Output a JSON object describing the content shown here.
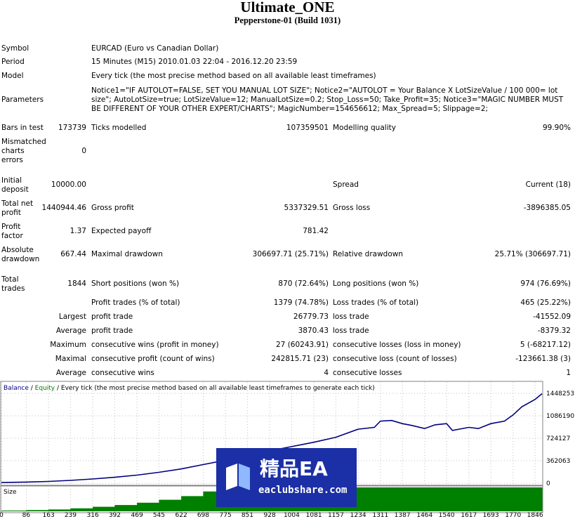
{
  "report": {
    "title": "Ultimate_ONE",
    "subtitle": "Pepperstone-01 (Build 1031)"
  },
  "info": {
    "symbol_label": "Symbol",
    "symbol": "EURCAD (Euro vs Canadian Dollar)",
    "period_label": "Period",
    "period": "15 Minutes (M15) 2010.01.03 22:04 - 2016.12.20 23:59",
    "model_label": "Model",
    "model": "Every tick (the most precise method based on all available least timeframes)",
    "parameters_label": "Parameters",
    "parameters": "Notice1=\"IF AUTOLOT=FALSE, SET YOU MANUAL LOT SIZE\"; Notice2=\"AUTOLOT = Your Balance X LotSizeValue / 100 000= lot size\"; AutoLotSize=true; LotSizeValue=12; ManualLotSize=0.2; Stop_Loss=50; Take_Profit=35; Notice3=\"MAGIC NUMBER MUST BE DIFFERENT OF YOUR OTHER EXPERT/CHARTS\"; MagicNumber=154656612; Max_Spread=5; Slippage=2;"
  },
  "stats": {
    "bars_label": "Bars in test",
    "bars": "173739",
    "ticks_label": "Ticks modelled",
    "ticks": "107359501",
    "quality_label": "Modelling quality",
    "quality": "99.90%",
    "mismatch_label": "Mismatched charts errors",
    "mismatch": "0",
    "deposit_label": "Initial deposit",
    "deposit": "10000.00",
    "spread_label": "Spread",
    "spread": "Current (18)",
    "netprofit_label": "Total net profit",
    "netprofit": "1440944.46",
    "grossprofit_label": "Gross profit",
    "grossprofit": "5337329.51",
    "grossloss_label": "Gross loss",
    "grossloss": "-3896385.05",
    "pf_label": "Profit factor",
    "pf": "1.37",
    "payoff_label": "Expected payoff",
    "payoff": "781.42",
    "absdd_label": "Absolute drawdown",
    "absdd": "667.44",
    "maxdd_label": "Maximal drawdown",
    "maxdd": "306697.71 (25.71%)",
    "reldd_label": "Relative drawdown",
    "reldd": "25.71% (306697.71)",
    "trades_label": "Total trades",
    "trades": "1844",
    "short_label": "Short positions (won %)",
    "short": "870 (72.64%)",
    "long_label": "Long positions (won %)",
    "long": "974 (76.69%)",
    "profittr_label": "Profit trades (% of total)",
    "profittr": "1379 (74.78%)",
    "losstr_label": "Loss trades (% of total)",
    "losstr": "465 (25.22%)",
    "largest_label": "Largest",
    "largest_p_label": "profit trade",
    "largest_p": "26779.73",
    "largest_l_label": "loss trade",
    "largest_l": "-41552.09",
    "average_label": "Average",
    "average_p_label": "profit trade",
    "average_p": "3870.43",
    "average_l_label": "loss trade",
    "average_l": "-8379.32",
    "maximum_label": "Maximum",
    "maxwins_label": "consecutive wins (profit in money)",
    "maxwins": "27 (60243.91)",
    "maxloss_label": "consecutive losses (loss in money)",
    "maxloss": "5 (-68217.12)",
    "maximal_label": "Maximal",
    "maxprofit_label": "consecutive profit (count of wins)",
    "maxprofit": "242815.71 (23)",
    "maxlosscount_label": "consecutive loss (count of losses)",
    "maxlosscount": "-123661.38 (3)",
    "average2_label": "Average",
    "avgwins_label": "consecutive wins",
    "avgwins": "4",
    "avglosses_label": "consecutive losses",
    "avglosses": "1"
  },
  "chart_data": {
    "type": "line",
    "legend_balance": "Balance",
    "legend_sep": " / ",
    "legend_equity": "Equity",
    "legend_rest": " / Every tick (the most precise method based on all available least timeframes to generate each tick)",
    "size_label": "Size",
    "y_ticks": [
      "1448253",
      "1086190",
      "724127",
      "362063",
      "0"
    ],
    "x_ticks": [
      "0",
      "86",
      "163",
      "239",
      "316",
      "392",
      "469",
      "545",
      "622",
      "698",
      "775",
      "851",
      "928",
      "1004",
      "1081",
      "1157",
      "1234",
      "1311",
      "1387",
      "1464",
      "1540",
      "1617",
      "1693",
      "1770",
      "1846"
    ],
    "series": [
      {
        "name": "Balance",
        "x": [
          0,
          86,
          163,
          239,
          316,
          392,
          469,
          545,
          622,
          698,
          775,
          851,
          928,
          1004,
          1081,
          1157,
          1234,
          1290,
          1311,
          1350,
          1387,
          1420,
          1464,
          1500,
          1540,
          1560,
          1617,
          1650,
          1693,
          1740,
          1770,
          1800,
          1846,
          1870
        ],
        "values": [
          10000,
          18000,
          28000,
          45000,
          68000,
          95000,
          130000,
          175000,
          230000,
          300000,
          370000,
          430000,
          520000,
          590000,
          660000,
          740000,
          870000,
          900000,
          1000000,
          1010000,
          960000,
          930000,
          880000,
          940000,
          960000,
          850000,
          900000,
          880000,
          960000,
          1000000,
          1100000,
          1230000,
          1350000,
          1440944
        ]
      }
    ],
    "ylim": [
      0,
      1448253
    ]
  },
  "watermark": {
    "text": "精品EA",
    "url": "eaclubshare.com"
  },
  "colors": {
    "balance": "#000080",
    "equity": "#008000",
    "grid": "#c0c0c0",
    "banner": "#1b2fa6"
  }
}
